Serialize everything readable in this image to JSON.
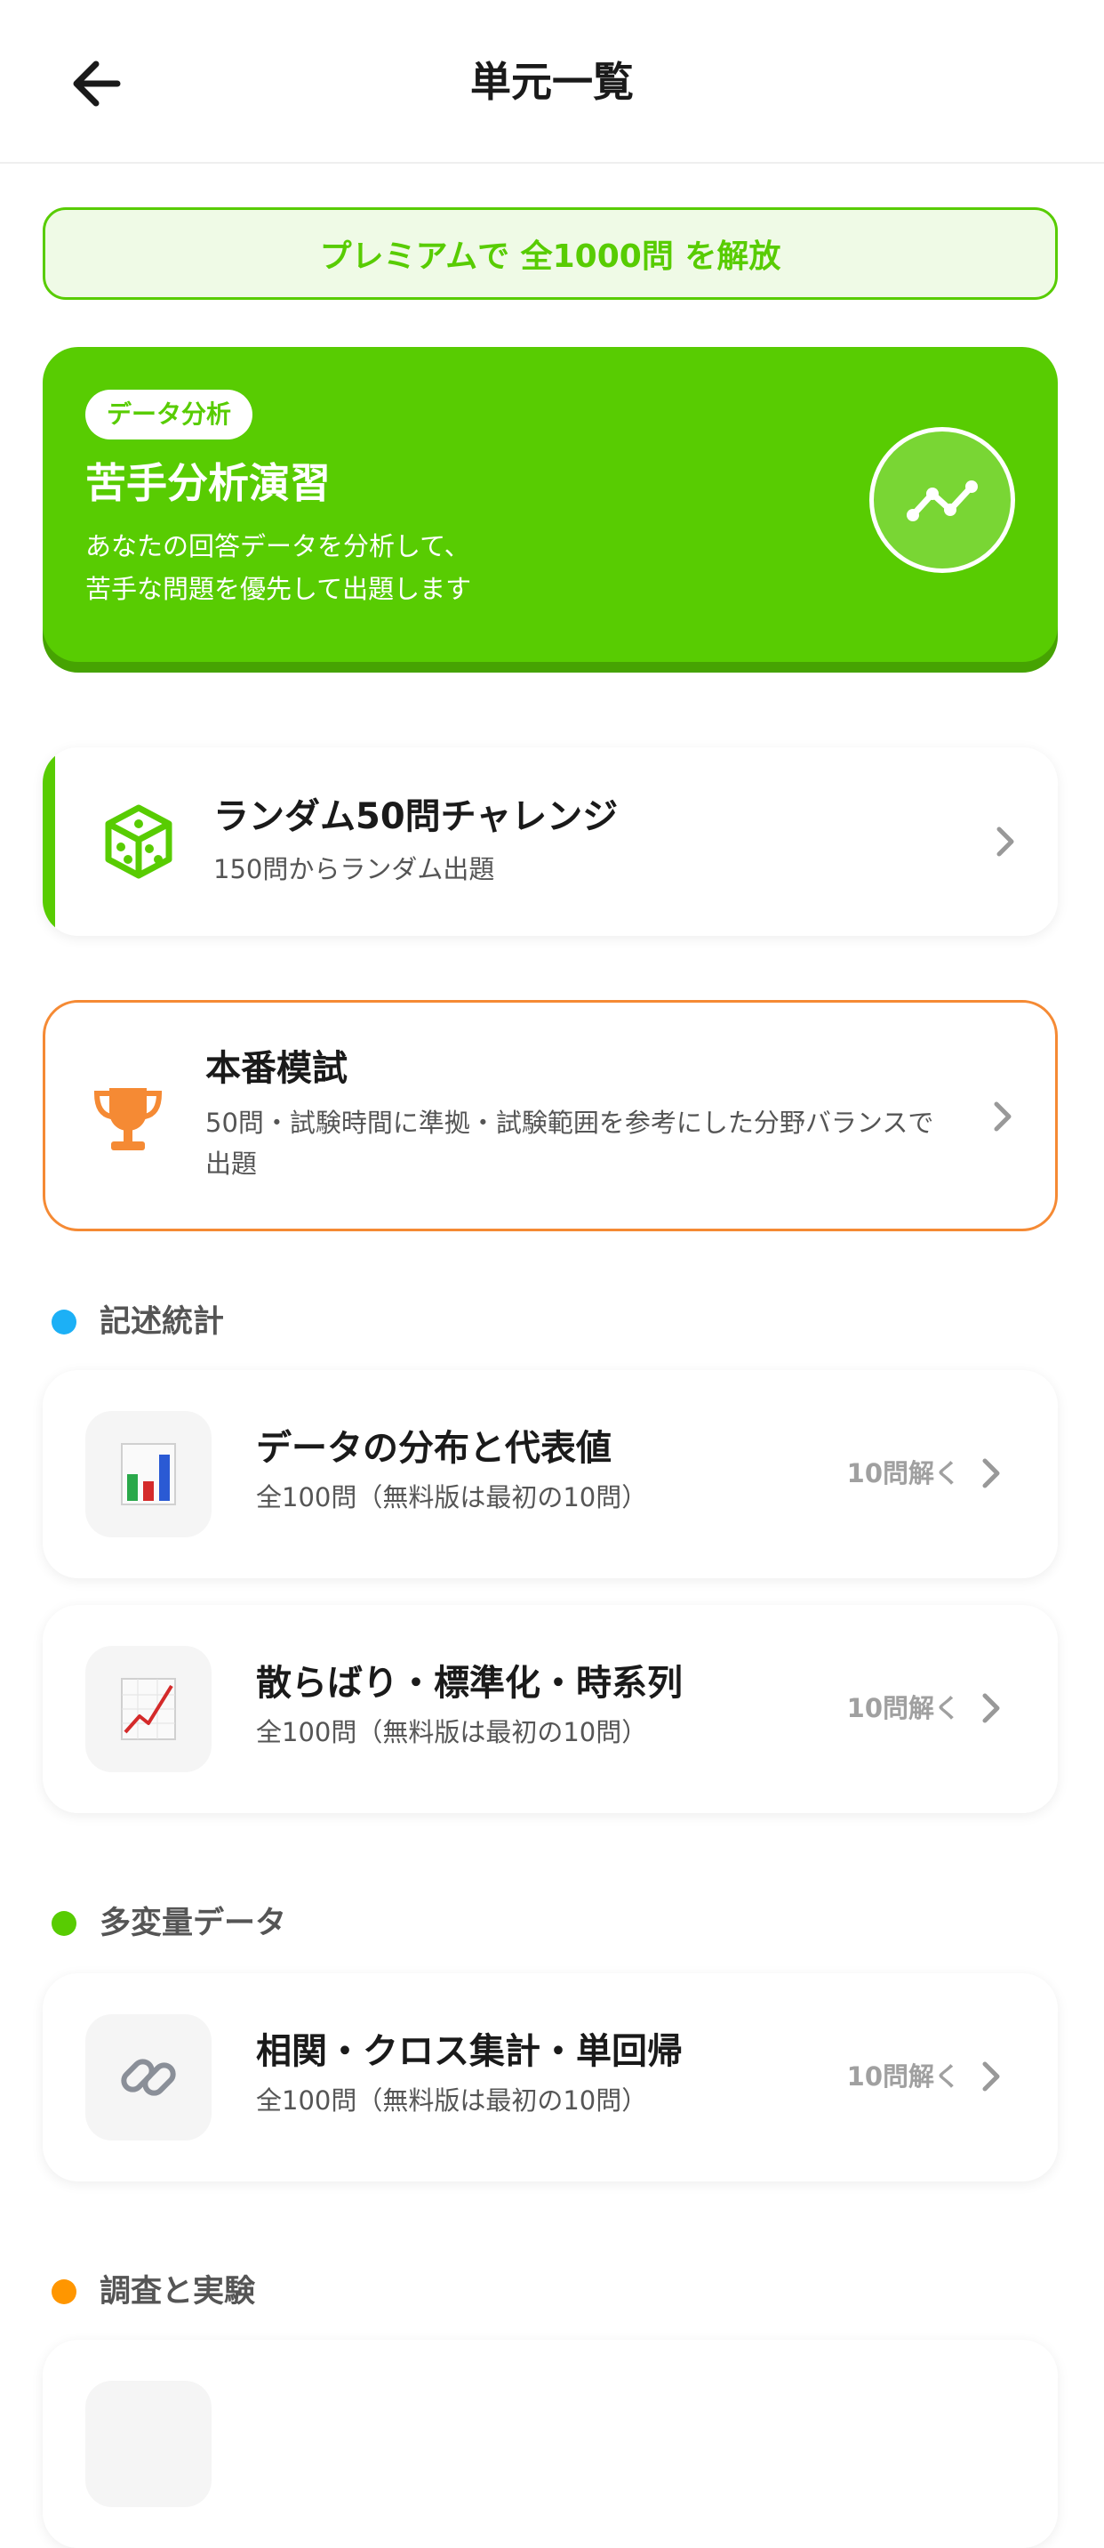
{
  "header": {
    "title": "単元一覧",
    "back_icon": "arrow-left-icon"
  },
  "premium_banner": {
    "text": "プレミアムで 全1000問 を解放"
  },
  "feature": {
    "badge": "データ分析",
    "title": "苦手分析演習",
    "description": "あなたの回答データを分析して、\n苦手な問題を優先して出題します",
    "icon": "trend-line-icon"
  },
  "random_challenge": {
    "title": "ランダム50問チャレンジ",
    "subtitle": "150問からランダム出題",
    "icon": "dice-icon"
  },
  "mock_exam": {
    "title": "本番模試",
    "subtitle": "50問・試験時間に準拠・試験範囲を参考にした分野バランスで出題",
    "icon": "trophy-icon"
  },
  "sections": [
    {
      "label": "記述統計",
      "color": "#1cb0f6",
      "units": [
        {
          "title": "データの分布と代表値",
          "subtitle": "全100問（無料版は最初の10問）",
          "action": "10問解く",
          "icon": "bar-chart-icon"
        },
        {
          "title": "散らばり・標準化・時系列",
          "subtitle": "全100問（無料版は最初の10問）",
          "action": "10問解く",
          "icon": "line-chart-icon"
        }
      ]
    },
    {
      "label": "多変量データ",
      "color": "#58cc02",
      "units": [
        {
          "title": "相関・クロス集計・単回帰",
          "subtitle": "全100問（無料版は最初の10問）",
          "action": "10問解く",
          "icon": "link-icon"
        }
      ]
    },
    {
      "label": "調査と実験",
      "color": "#ff9600",
      "units": []
    }
  ],
  "colors": {
    "primary_green": "#58cc02",
    "orange": "#f58a34",
    "blue": "#1cb0f6"
  }
}
